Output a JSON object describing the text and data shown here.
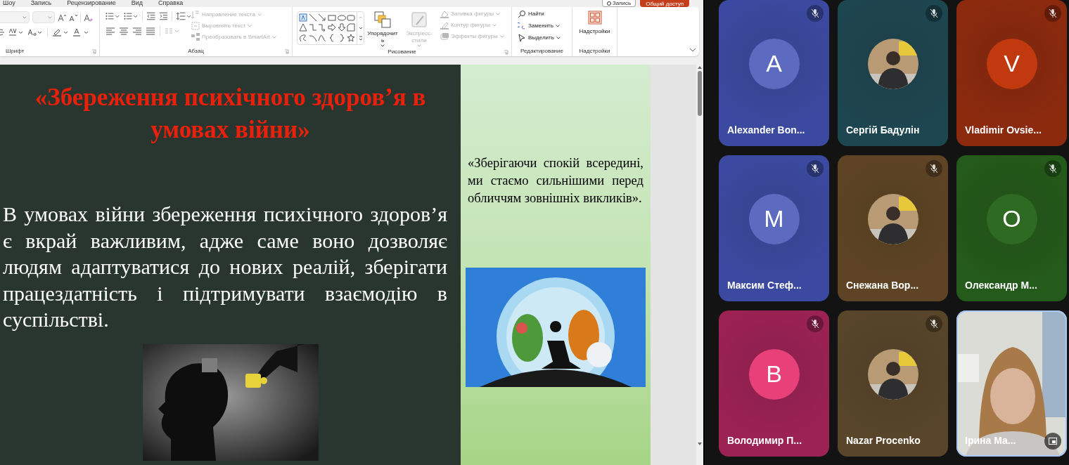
{
  "menu": [
    {
      "label": "Шоу"
    },
    {
      "label": "Запись"
    },
    {
      "label": "Рецензирование"
    },
    {
      "label": "Вид"
    },
    {
      "label": "Справка"
    }
  ],
  "record_button": {
    "label": "Запись"
  },
  "share_button": {
    "label": "Общий доступ"
  },
  "ribbon": {
    "groups": [
      {
        "label": "Шрифт",
        "launcher": true
      },
      {
        "label": "Абзац",
        "launcher": true,
        "commands": [
          {
            "label": "Направление текста",
            "disabled": true,
            "dropdown": true
          },
          {
            "label": "Выровнять текст",
            "disabled": true,
            "dropdown": true
          },
          {
            "label": "Преобразовать в SmartArt",
            "disabled": true,
            "dropdown": true
          }
        ]
      },
      {
        "label": "Рисование",
        "launcher": true,
        "commands": [
          {
            "kind": "large",
            "label": "Упорядочить",
            "disabled": false,
            "dropdown": true
          },
          {
            "kind": "large",
            "label": "Экспресс-стили",
            "disabled": true,
            "dropdown": true
          },
          {
            "kind": "small",
            "label": "Заливка фигуры",
            "disabled": true,
            "dropdown": true
          },
          {
            "kind": "small",
            "label": "Контур фигуры",
            "disabled": true,
            "dropdown": true
          },
          {
            "kind": "small",
            "label": "Эффекты фигуры",
            "disabled": true,
            "dropdown": true
          }
        ]
      },
      {
        "label": "Редактирование",
        "launcher": false,
        "commands": [
          {
            "label": "Найти",
            "disabled": false,
            "dropdown": false
          },
          {
            "label": "Заменить",
            "disabled": false,
            "dropdown": true
          },
          {
            "label": "Выделить",
            "disabled": false,
            "dropdown": true
          }
        ]
      },
      {
        "label": "Надстройки",
        "launcher": false,
        "commands": [
          {
            "label": "Надстройки",
            "disabled": false,
            "dropdown": false
          }
        ]
      }
    ]
  },
  "slide": {
    "title": "«Збереження психічного здоров’я в умовах війни»",
    "body": "В умовах війни збереження психічного здоров’я є вкрай важливим, адже саме воно дозволяє людям адаптуватися до нових реалій, зберігати працездатність і підтримувати взаємодію в суспільстві.",
    "quote": "«Зберігаючи спокій всередині, ми стаємо сильнішими перед обличчям зовнішніх викликів»."
  },
  "participants": [
    {
      "name": "Alexander Bon...",
      "color": "#3b4aa0",
      "avatar": {
        "kind": "initial",
        "initial": "A",
        "color": "#5c6bc0"
      },
      "muted": true,
      "speaking": false
    },
    {
      "name": "Сергій Бадулін",
      "color": "#1e4650",
      "muted": true,
      "speaking": false
    },
    {
      "name": "Vladimir Ovsie...",
      "color": "#8c2a0e",
      "avatar": {
        "kind": "initial",
        "initial": "V",
        "color": "#c2390f"
      },
      "muted": true,
      "speaking": false
    },
    {
      "name": "Максим Стеф...",
      "color": "#3b4aa0",
      "avatar": {
        "kind": "initial",
        "initial": "M",
        "color": "#5c6bc0"
      },
      "muted": true,
      "speaking": false
    },
    {
      "name": "Снежана Вор...",
      "color": "#5e4424",
      "muted": true,
      "speaking": false
    },
    {
      "name": "Олександр М...",
      "color": "#245a1a",
      "avatar": {
        "kind": "initial",
        "initial": "O",
        "color": "#2e6a22"
      },
      "muted": true,
      "speaking": false
    },
    {
      "name": "Володимир П...",
      "color": "#9c2254",
      "avatar": {
        "kind": "initial",
        "initial": "B",
        "color": "#e8417a"
      },
      "muted": true,
      "speaking": false
    },
    {
      "name": "Nazar Procenko",
      "color": "#58452a",
      "muted": true,
      "speaking": false
    },
    {
      "name": "Ірина Ма...",
      "color": "#d8d8d4",
      "avatar": {
        "kind": "video"
      },
      "muted": false,
      "speaking": true
    }
  ]
}
